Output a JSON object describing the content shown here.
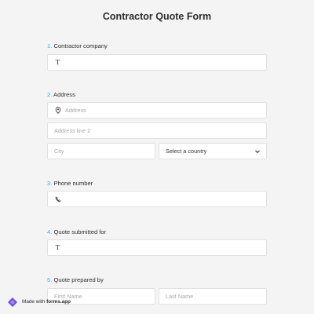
{
  "form": {
    "title": "Contractor Quote Form"
  },
  "questions": [
    {
      "num": "1.",
      "label": "Contractor company"
    },
    {
      "num": "2.",
      "label": "Address"
    },
    {
      "num": "3.",
      "label": "Phone number"
    },
    {
      "num": "4.",
      "label": "Quote submitted for"
    },
    {
      "num": "5.",
      "label": "Quote prepared by"
    }
  ],
  "address": {
    "line1_placeholder": "Address",
    "line2_placeholder": "Address line 2",
    "city_placeholder": "City",
    "country_value": "Select a country"
  },
  "name": {
    "first_placeholder": "First Name",
    "last_placeholder": "Last Name"
  },
  "badge": {
    "made_with": "Made with",
    "brand": "forms.app"
  },
  "colors": {
    "accent": "#2bb5d4",
    "brand": "#6b4de6",
    "background": "#f4f4f4"
  },
  "icons": {
    "text": "text-icon",
    "location": "location-pin-icon",
    "phone": "phone-icon",
    "dropdown": "chevron-down-icon"
  }
}
